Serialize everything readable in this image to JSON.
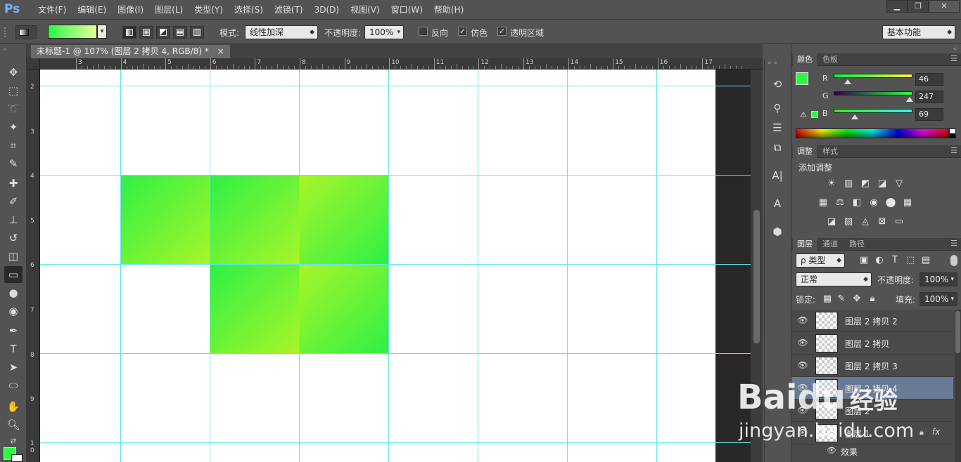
{
  "app": {
    "logo": "Ps"
  },
  "menu": [
    "文件(F)",
    "编辑(E)",
    "图像(I)",
    "图层(L)",
    "类型(Y)",
    "选择(S)",
    "滤镜(T)",
    "3D(D)",
    "视图(V)",
    "窗口(W)",
    "帮助(H)"
  ],
  "window_controls": {
    "minimize": "▁",
    "restore": "❐",
    "close": "✕"
  },
  "options": {
    "mode_label": "模式:",
    "mode_value": "线性加深",
    "opacity_label": "不透明度:",
    "opacity_value": "100%",
    "reverse_label": "反向",
    "dither_label": "仿色",
    "transparency_label": "透明区域",
    "workspace": "基本功能",
    "gradient_start": "#2ef745",
    "gradient_end": "#e6ff9a"
  },
  "document": {
    "tab_title": "未标题-1 @ 107% (图层 2 拷贝 4, RGB/8) *",
    "tab_close": "×",
    "ruler_top_labels": [
      "3",
      "4",
      "5",
      "6",
      "7",
      "8",
      "9",
      "10",
      "11",
      "12",
      "13",
      "14",
      "15",
      "16",
      "17"
    ],
    "ruler_left_labels": [
      "2",
      "3",
      "4",
      "5",
      "6",
      "7",
      "8",
      "9",
      "1",
      "0"
    ],
    "guide_color": "#5fe8e8",
    "tile_green": "#2ef045",
    "tile_yellow": "#a8f52a"
  },
  "color_panel": {
    "tabs": [
      "颜色",
      "色板"
    ],
    "r_label": "R",
    "g_label": "G",
    "b_label": "B",
    "r_value": "46",
    "g_value": "247",
    "b_value": "69",
    "r": 46,
    "g": 247,
    "b": 69,
    "foreground": "#2ef745",
    "background": "#ffffff"
  },
  "adjust_panel": {
    "tabs": [
      "调整",
      "样式"
    ],
    "title": "添加调整",
    "row1": [
      "☀",
      "▥",
      "◩",
      "◪",
      "▽"
    ],
    "row2": [
      "▦",
      "⚖",
      "◧",
      "◉",
      "⬤",
      "▦"
    ],
    "row3": [
      "◪",
      "▨",
      "◬",
      "⊠",
      "▭"
    ]
  },
  "layers_panel": {
    "tabs": [
      "图层",
      "通道",
      "路径"
    ],
    "filter_label": "ρ 类型",
    "blend_mode": "正常",
    "opacity_label": "不透明度:",
    "opacity_value": "100%",
    "lock_label": "锁定:",
    "fill_label": "填充:",
    "fill_value": "100%",
    "layers": [
      "图层 2 拷贝 2",
      "图层 2 拷贝",
      "图层 2 拷贝 3",
      "图层 2 拷贝 4",
      "图层 2",
      "图层 1"
    ],
    "effects_label": "效果",
    "fx_label": "fx"
  },
  "watermark": {
    "brand": "Bai",
    "paw": "du",
    "cn": "经验",
    "url": "jingyan.baidu.com"
  }
}
